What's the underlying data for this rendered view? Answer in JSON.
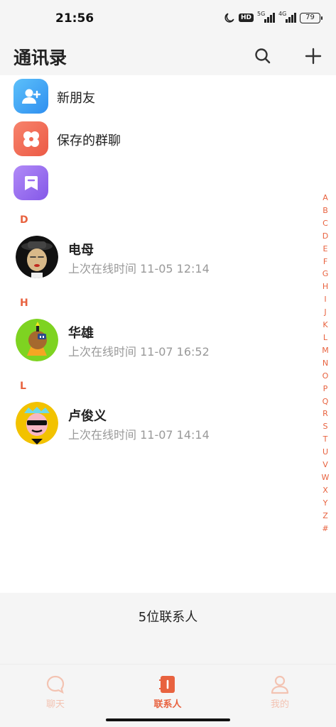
{
  "status_bar": {
    "time": "21:56",
    "hd": "HD",
    "net1": "5G",
    "net2": "4G",
    "battery": "79"
  },
  "header": {
    "title": "通讯录"
  },
  "functions": [
    {
      "label": "新朋友",
      "color": "#3aa6f2",
      "icon": "add-user-icon"
    },
    {
      "label": "保存的群聊",
      "color": "#f06b55",
      "icon": "flower-icon"
    },
    {
      "label": "",
      "color": "#9a6ff0",
      "icon": "bookmark-icon"
    }
  ],
  "sections": [
    {
      "letter": "D",
      "contacts": [
        {
          "name": "电母",
          "status": "上次在线时间 11-05 12:14"
        }
      ]
    },
    {
      "letter": "H",
      "contacts": [
        {
          "name": "华雄",
          "status": "上次在线时间 11-07 16:52"
        }
      ]
    },
    {
      "letter": "L",
      "contacts": [
        {
          "name": "卢俊义",
          "status": "上次在线时间 11-07 14:14"
        }
      ]
    }
  ],
  "alphabet": [
    "A",
    "B",
    "C",
    "D",
    "E",
    "F",
    "G",
    "H",
    "I",
    "J",
    "K",
    "L",
    "M",
    "N",
    "O",
    "P",
    "Q",
    "R",
    "S",
    "T",
    "U",
    "V",
    "W",
    "X",
    "Y",
    "Z",
    "#"
  ],
  "contact_count": "5位联系人",
  "nav": {
    "chat": "聊天",
    "contacts": "联系人",
    "me": "我的"
  },
  "colors": {
    "accent": "#e8623f",
    "inactive": "#f3c3b2"
  }
}
